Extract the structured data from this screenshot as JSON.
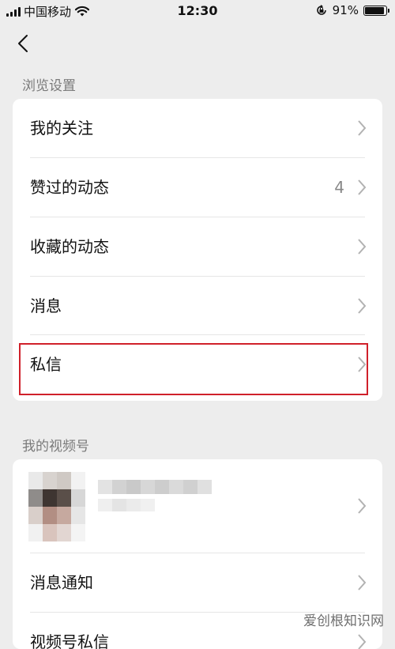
{
  "status_bar": {
    "carrier": "中国移动",
    "time": "12:30",
    "battery": "91%",
    "battery_level": 0.91
  },
  "sections": {
    "browse_title": "浏览设置",
    "channel_title": "我的视频号"
  },
  "browse_items": [
    {
      "label": "我的关注",
      "value": ""
    },
    {
      "label": "赞过的动态",
      "value": "4"
    },
    {
      "label": "收藏的动态",
      "value": ""
    },
    {
      "label": "消息",
      "value": ""
    },
    {
      "label": "私信",
      "value": ""
    }
  ],
  "channel_items": [
    {
      "label": "消息通知"
    },
    {
      "label": "视频号私信"
    }
  ],
  "colors": {
    "highlight": "#d0202a",
    "background": "#ededed"
  },
  "icons": [
    "signal-icon",
    "wifi-icon",
    "lock-rotation-icon",
    "battery-icon",
    "back-icon",
    "chevron-right-icon"
  ],
  "watermark": "爱创根知识网"
}
